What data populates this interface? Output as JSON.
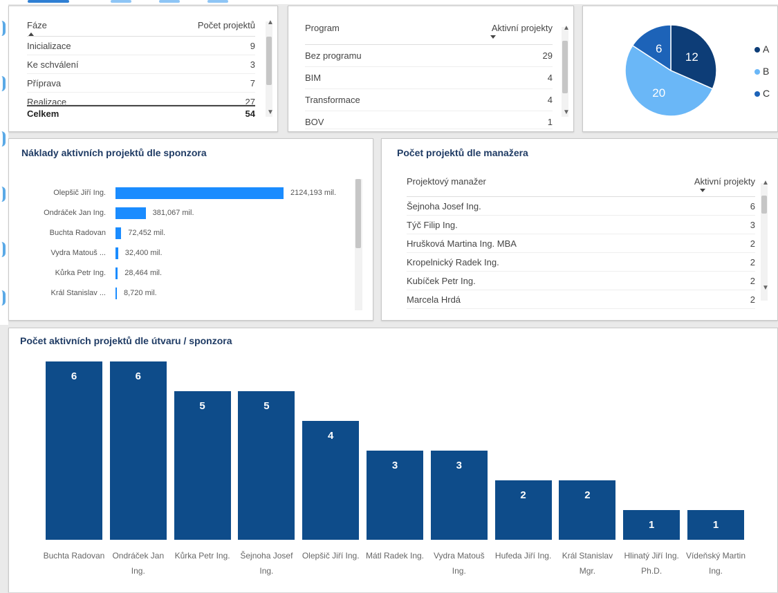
{
  "status_table": {
    "col_phase": "Fáze",
    "col_count": "Počet projektů",
    "rows": [
      {
        "phase": "Inicializace",
        "count": "9"
      },
      {
        "phase": "Ke schválení",
        "count": "3"
      },
      {
        "phase": "Příprava",
        "count": "7"
      },
      {
        "phase": "Realizace",
        "count": "27"
      }
    ],
    "total_label": "Celkem",
    "total_value": "54"
  },
  "program_table": {
    "col_program": "Program",
    "col_active": "Aktivní projekty",
    "rows": [
      {
        "program": "Bez programu",
        "count": "29"
      },
      {
        "program": "BIM",
        "count": "4"
      },
      {
        "program": "Transformace",
        "count": "4"
      },
      {
        "program": "BOV",
        "count": "1"
      }
    ]
  },
  "pie": {
    "slices": [
      {
        "label": "C",
        "value": 12,
        "color": "#0d3d77"
      },
      {
        "label": "B",
        "value": 20,
        "color": "#6ab7f7"
      },
      {
        "label": "A",
        "value": 6,
        "color": "#1d63b8"
      }
    ],
    "legend": [
      {
        "label": "A",
        "color": "#0d3d77"
      },
      {
        "label": "B",
        "color": "#6ab7f7"
      },
      {
        "label": "C",
        "color": "#1d63b8"
      }
    ]
  },
  "sponsor_costs": {
    "title": "Náklady aktivních projektů dle sponzora",
    "rows": [
      {
        "name": "Olepšič Jiří Ing.",
        "value": 2124.193,
        "label": "2124,193 mil."
      },
      {
        "name": "Ondráček Jan Ing.",
        "value": 381.067,
        "label": "381,067 mil."
      },
      {
        "name": "Buchta Radovan",
        "value": 72.452,
        "label": "72,452 mil."
      },
      {
        "name": "Vydra Matouš ...",
        "value": 32.4,
        "label": "32,400 mil."
      },
      {
        "name": "Kůrka Petr Ing.",
        "value": 28.464,
        "label": "28,464 mil."
      },
      {
        "name": "Král Stanislav ...",
        "value": 8.72,
        "label": "8,720 mil."
      }
    ]
  },
  "manager_table": {
    "title": "Počet projektů dle manažera",
    "col_manager": "Projektový manažer",
    "col_active": "Aktivní projekty",
    "rows": [
      {
        "name": "Šejnoha Josef Ing.",
        "count": "6"
      },
      {
        "name": "Týč Filip Ing.",
        "count": "3"
      },
      {
        "name": "Hrušková Martina Ing. MBA",
        "count": "2"
      },
      {
        "name": "Kropelnický Radek Ing.",
        "count": "2"
      },
      {
        "name": "Kubíček Petr Ing.",
        "count": "2"
      },
      {
        "name": "Marcela Hrdá",
        "count": "2"
      }
    ]
  },
  "chart_data": {
    "type": "bar",
    "title": "Počet aktivních projektů dle útvaru / sponzora",
    "categories": [
      "Buchta Radovan",
      "Ondráček Jan Ing.",
      "Kůrka Petr Ing.",
      "Šejnoha Josef Ing.",
      "Olepšič Jiří Ing.",
      "Mátl Radek Ing.",
      "Vydra Matouš Ing.",
      "Hufeda Jiří Ing.",
      "Král Stanislav Mgr.",
      "Hlinatý Jiří Ing. Ph.D.",
      "Vídeňský Martin Ing."
    ],
    "values": [
      6,
      6,
      5,
      5,
      4,
      3,
      3,
      2,
      2,
      1,
      1
    ],
    "ylim": [
      0,
      6
    ],
    "grid": false,
    "color": "#0e4c8a"
  }
}
